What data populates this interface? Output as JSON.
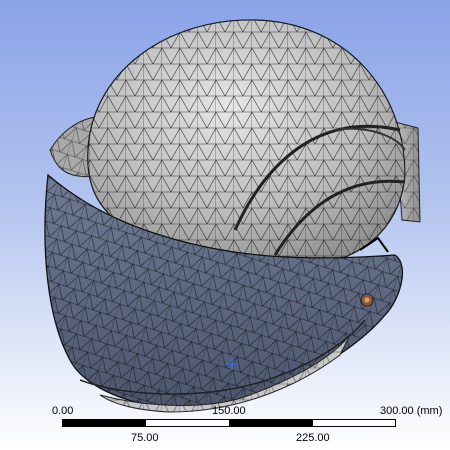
{
  "viewport": {
    "background_top": "#8aa3e8",
    "background_bottom": "#ffffff",
    "model_name": "helmet-mesh",
    "mesh_face_color": "#c6c6c6",
    "visor_face_color": "#5f6b83",
    "mesh_edge_color": "#111111",
    "triad_marker": "blue-plus-icon"
  },
  "scale_bar": {
    "label_start": "0.00",
    "label_mid_top": "150.00",
    "label_end": "300.00 (mm)",
    "label_q1": "75.00",
    "label_q3": "225.00"
  }
}
